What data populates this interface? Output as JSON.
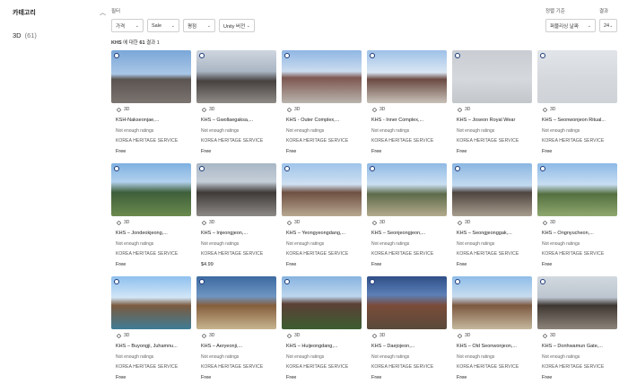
{
  "sidebar": {
    "title": "카테고리",
    "item": {
      "label": "3D",
      "count": "(61)"
    }
  },
  "filters": {
    "label": "필터",
    "dropdowns": [
      "가격",
      "Sale",
      "평점",
      "Unity 버전"
    ]
  },
  "sort": {
    "label": "정렬 기준",
    "value": "퍼블리싱 날짜"
  },
  "per_page": {
    "label": "결과",
    "value": "24"
  },
  "results": {
    "query": "KHS",
    "mid": "에 대한",
    "count": "61",
    "suffix": "결과 1"
  },
  "cards": [
    {
      "badge": "3D",
      "title": "KSH-Nakseonjae,...",
      "rating": "Not enough ratings",
      "publisher": "KOREA HERITAGE SERVICE",
      "price": "Free"
    },
    {
      "badge": "3D",
      "title": "KHS – Gwollaegaksa,...",
      "rating": "Not enough ratings",
      "publisher": "KOREA HERITAGE SERVICE",
      "price": "Free"
    },
    {
      "badge": "3D",
      "title": "KHS - Outer Complex,...",
      "rating": "Not enough ratings",
      "publisher": "KOREA HERITAGE SERVICE",
      "price": "Free"
    },
    {
      "badge": "3D",
      "title": "KHS - Inner Complex,...",
      "rating": "Not enough ratings",
      "publisher": "KOREA HERITAGE SERVICE",
      "price": "Free"
    },
    {
      "badge": "3D",
      "title": "KHS – Joseon Royal Wear",
      "rating": "Not enough ratings",
      "publisher": "KOREA HERITAGE SERVICE",
      "price": "Free"
    },
    {
      "badge": "3D",
      "title": "KHS – Seonwonjeon Ritual...",
      "rating": "Not enough ratings",
      "publisher": "KOREA HERITAGE SERVICE",
      "price": "Free"
    },
    {
      "badge": "3D",
      "title": "KHS – Jondeokjeong,...",
      "rating": "Not enough ratings",
      "publisher": "KOREA HERITAGE SERVICE",
      "price": "Free"
    },
    {
      "badge": "3D",
      "title": "KHS – Injeongjeon,...",
      "rating": "Not enough ratings",
      "publisher": "KOREA HERITAGE SERVICE",
      "price": "$4.99"
    },
    {
      "badge": "3D",
      "title": "KHS – Yeongyeongdang,...",
      "rating": "Not enough ratings",
      "publisher": "KOREA HERITAGE SERVICE",
      "price": "Free"
    },
    {
      "badge": "3D",
      "title": "KHS – Seonjeongjeon,...",
      "rating": "Not enough ratings",
      "publisher": "KOREA HERITAGE SERVICE",
      "price": "Free"
    },
    {
      "badge": "3D",
      "title": "KHS – Seongjeonggak,...",
      "rating": "Not enough ratings",
      "publisher": "KOREA HERITAGE SERVICE",
      "price": "Free"
    },
    {
      "badge": "3D",
      "title": "KHS – Ongnyucheon,...",
      "rating": "Not enough ratings",
      "publisher": "KOREA HERITAGE SERVICE",
      "price": "Free"
    },
    {
      "badge": "3D",
      "title": "KHS – Buyongji, Juhamnu...",
      "rating": "Not enough ratings",
      "publisher": "KOREA HERITAGE SERVICE",
      "price": "Free"
    },
    {
      "badge": "3D",
      "title": "KHS – Aeryeonji,...",
      "rating": "Not enough ratings",
      "publisher": "KOREA HERITAGE SERVICE",
      "price": "Free"
    },
    {
      "badge": "3D",
      "title": "KHS – Huijeongdang,...",
      "rating": "Not enough ratings",
      "publisher": "KOREA HERITAGE SERVICE",
      "price": "Free"
    },
    {
      "badge": "3D",
      "title": "KHS – Daejojeon,...",
      "rating": "Not enough ratings",
      "publisher": "KOREA HERITAGE SERVICE",
      "price": "Free"
    },
    {
      "badge": "3D",
      "title": "KHS – Old Seonwonjeon,...",
      "rating": "Not enough ratings",
      "publisher": "KOREA HERITAGE SERVICE",
      "price": "Free"
    },
    {
      "badge": "3D",
      "title": "KHS – Donhwamun Gate,...",
      "rating": "Not enough ratings",
      "publisher": "KOREA HERITAGE SERVICE",
      "price": "Free"
    }
  ],
  "icons": {
    "collapse": "chevron-up-icon",
    "dropdown": "chevron-down-icon",
    "badge": "cube-3d-icon",
    "logo": "heritage-logo-icon"
  }
}
